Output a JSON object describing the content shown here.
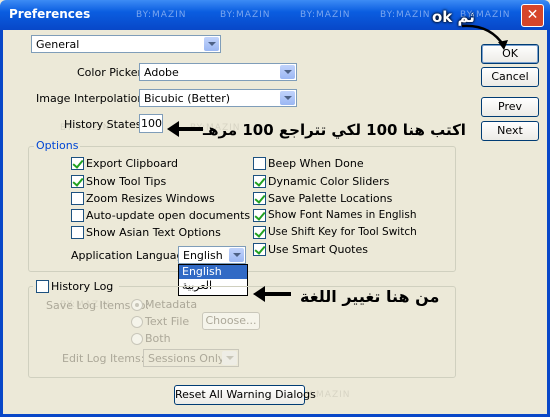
{
  "window": {
    "title": "Preferences",
    "watermark": "BY:MAZIN",
    "close_symbol": "✕"
  },
  "top_select": {
    "value": "General"
  },
  "fields": {
    "color_picker": {
      "label": "Color Picker:",
      "value": "Adobe"
    },
    "image_interpolation": {
      "label": "Image Interpolation:",
      "value": "Bicubic (Better)"
    },
    "history_states": {
      "label": "History States:",
      "value": "100"
    }
  },
  "buttons": {
    "ok": "OK",
    "cancel": "Cancel",
    "prev": "Prev",
    "next": "Next"
  },
  "options": {
    "legend": "Options",
    "left": [
      {
        "label": "Export Clipboard",
        "checked": true
      },
      {
        "label": "Show Tool Tips",
        "checked": true
      },
      {
        "label": "Zoom Resizes Windows",
        "checked": false
      },
      {
        "label": "Auto-update open documents",
        "checked": false
      },
      {
        "label": "Show Asian Text Options",
        "checked": false
      }
    ],
    "right": [
      {
        "label": "Beep When Done",
        "checked": false
      },
      {
        "label": "Dynamic Color Sliders",
        "checked": true
      },
      {
        "label": "Save Palette Locations",
        "checked": true
      },
      {
        "label": "Show Font Names in English",
        "checked": true
      },
      {
        "label": "Use Shift Key for Tool Switch",
        "checked": true
      },
      {
        "label": "Use Smart Quotes",
        "checked": true
      }
    ],
    "app_language": {
      "label": "Application Language:",
      "value": "English",
      "options": [
        "English",
        "العربية"
      ]
    }
  },
  "history_log": {
    "label": "History Log",
    "checked": false,
    "save_items_label": "Save Log Items To:",
    "radios": [
      "Metadata",
      "Text File",
      "Both"
    ],
    "choose_button": "Choose...",
    "edit_items_label": "Edit Log Items:",
    "edit_items_value": "Sessions Only"
  },
  "reset_button": "Reset All Warning Dialogs",
  "annotations": {
    "ok_note": "ثم ok",
    "history_note": "اكتب هنا 100 لكي تتراجع 100 مرهـ",
    "language_note": "من هنا تغيير اللغة"
  }
}
